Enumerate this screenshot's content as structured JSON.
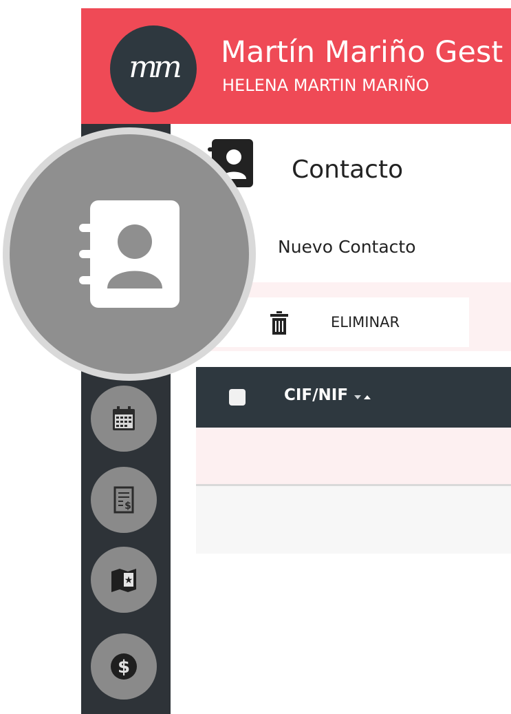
{
  "header": {
    "title": "Martín Mariño Gest",
    "subtitle": "HELENA MARTIN MARIÑO",
    "logo_text": "mm",
    "bg_color": "#ef4a56"
  },
  "sidebar": {
    "bg_color": "#2e3338",
    "items": [
      {
        "icon": "calendar-icon"
      },
      {
        "icon": "invoice-icon"
      },
      {
        "icon": "book-star-icon"
      },
      {
        "icon": "dollar-icon"
      }
    ]
  },
  "page": {
    "title": "Contacto",
    "title_icon": "contact-book-icon",
    "new_contact_label": "Nuevo Contacto"
  },
  "toolbar": {
    "delete_label": "ELIMINAR",
    "delete_icon": "trash-icon"
  },
  "table": {
    "columns": [
      "CIF/NIF"
    ],
    "header_bg": "#2e383f"
  },
  "magnifier": {
    "icon": "contact-book-icon"
  }
}
